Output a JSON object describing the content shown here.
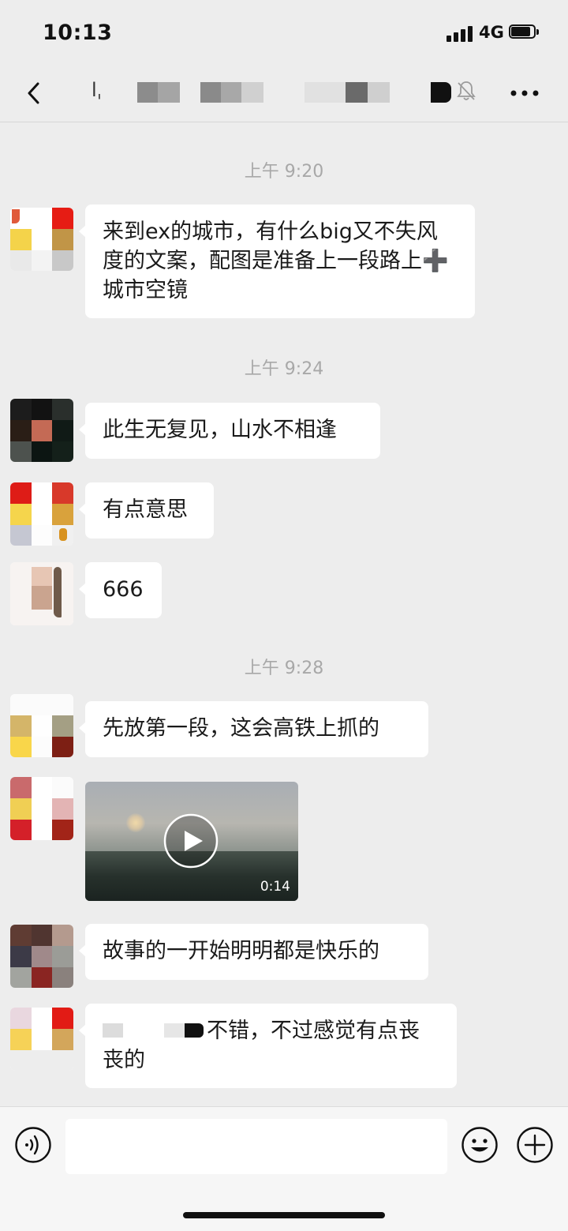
{
  "status_bar": {
    "time": "10:13",
    "network": "4G"
  },
  "nav": {
    "back_icon": "chevron-left-icon",
    "title_visible_fragment": "lˌ",
    "mute_icon": "bell-slash-icon",
    "more_icon": "ellipsis-icon"
  },
  "chat": {
    "timestamps": [
      "上午 9:20",
      "上午 9:24",
      "上午 9:28"
    ],
    "messages": [
      {
        "text": "来到ex的城市，有什么big又不失风度的文案，配图是准备上一段路上➕城市空镜"
      },
      {
        "text": "此生无复见，山水不相逢"
      },
      {
        "text": "有点意思"
      },
      {
        "text": "666"
      },
      {
        "text": "先放第一段，这会高铁上抓的"
      },
      {
        "type": "video",
        "duration": "0:14",
        "play_icon": "play-icon"
      },
      {
        "text": "故事的一开始明明都是快乐的"
      },
      {
        "text": "不错，不过感觉有点丧丧的",
        "prefix_redacted": true
      }
    ]
  },
  "input_bar": {
    "voice_icon": "voice-icon",
    "emoji_icon": "emoji-icon",
    "plus_icon": "plus-icon",
    "input_value": ""
  }
}
